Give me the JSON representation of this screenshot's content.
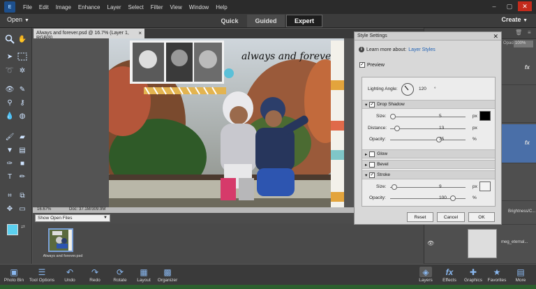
{
  "menubar": {
    "logo": "E",
    "menus": [
      "File",
      "Edit",
      "Image",
      "Enhance",
      "Layer",
      "Select",
      "Filter",
      "View",
      "Window",
      "Help"
    ],
    "window_controls": [
      "–",
      "▢",
      "✕"
    ]
  },
  "modebar": {
    "open_label": "Open",
    "modes": [
      "Quick",
      "Guided",
      "Expert"
    ],
    "active_mode": "Expert",
    "create_label": "Create"
  },
  "document": {
    "tab_title": "Always and forever.psd @ 16.7% (Layer 1, RGB/8)",
    "tab_close": "×",
    "zoom": "16.67%",
    "doc_size": "Doc: 37.1M/309.9M",
    "photo_text": "always and forever"
  },
  "bin": {
    "dropdown": "Show Open Files",
    "thumb_label": "Always and forever.psd"
  },
  "layers_panel": {
    "opacity_label": "Opacity:",
    "opacity_value": "100%",
    "fx_label": "fx",
    "layer_names": [
      "Brightness/C...",
      "meg_eternal..."
    ]
  },
  "dialog": {
    "title": "Style Settings",
    "close": "✕",
    "learn_text": "Learn more about:",
    "learn_link": "Layer Styles",
    "preview_label": "Preview",
    "lighting_label": "Lighting Angle:",
    "lighting_value": "120",
    "lighting_unit": "°",
    "sections": {
      "drop_shadow": "Drop Shadow",
      "glow": "Glow",
      "bevel": "Bevel",
      "stroke": "Stroke"
    },
    "drop_shadow": {
      "size_label": "Size:",
      "size_value": "5",
      "size_unit": "px",
      "distance_label": "Distance:",
      "distance_value": "13",
      "distance_unit": "px",
      "opacity_label": "Opacity:",
      "opacity_value": "75",
      "opacity_unit": "%",
      "color": "#000000"
    },
    "stroke": {
      "size_label": "Size:",
      "size_value": "9",
      "size_unit": "px",
      "opacity_label": "Opacity:",
      "opacity_value": "100",
      "opacity_unit": "%",
      "color": "#f4f4f4"
    },
    "buttons": {
      "reset": "Reset",
      "cancel": "Cancel",
      "ok": "OK"
    }
  },
  "bottombar": {
    "left": [
      "Photo Bin",
      "Tool Options",
      "Undo",
      "Redo",
      "Rotate",
      "Layout",
      "Organizer"
    ],
    "right": [
      "Layers",
      "Effects",
      "Graphics",
      "Favorites",
      "More"
    ]
  },
  "colors": {
    "foreground": "#5bd0ef",
    "background": "#ffffff",
    "accent": "#4a6fa8"
  }
}
